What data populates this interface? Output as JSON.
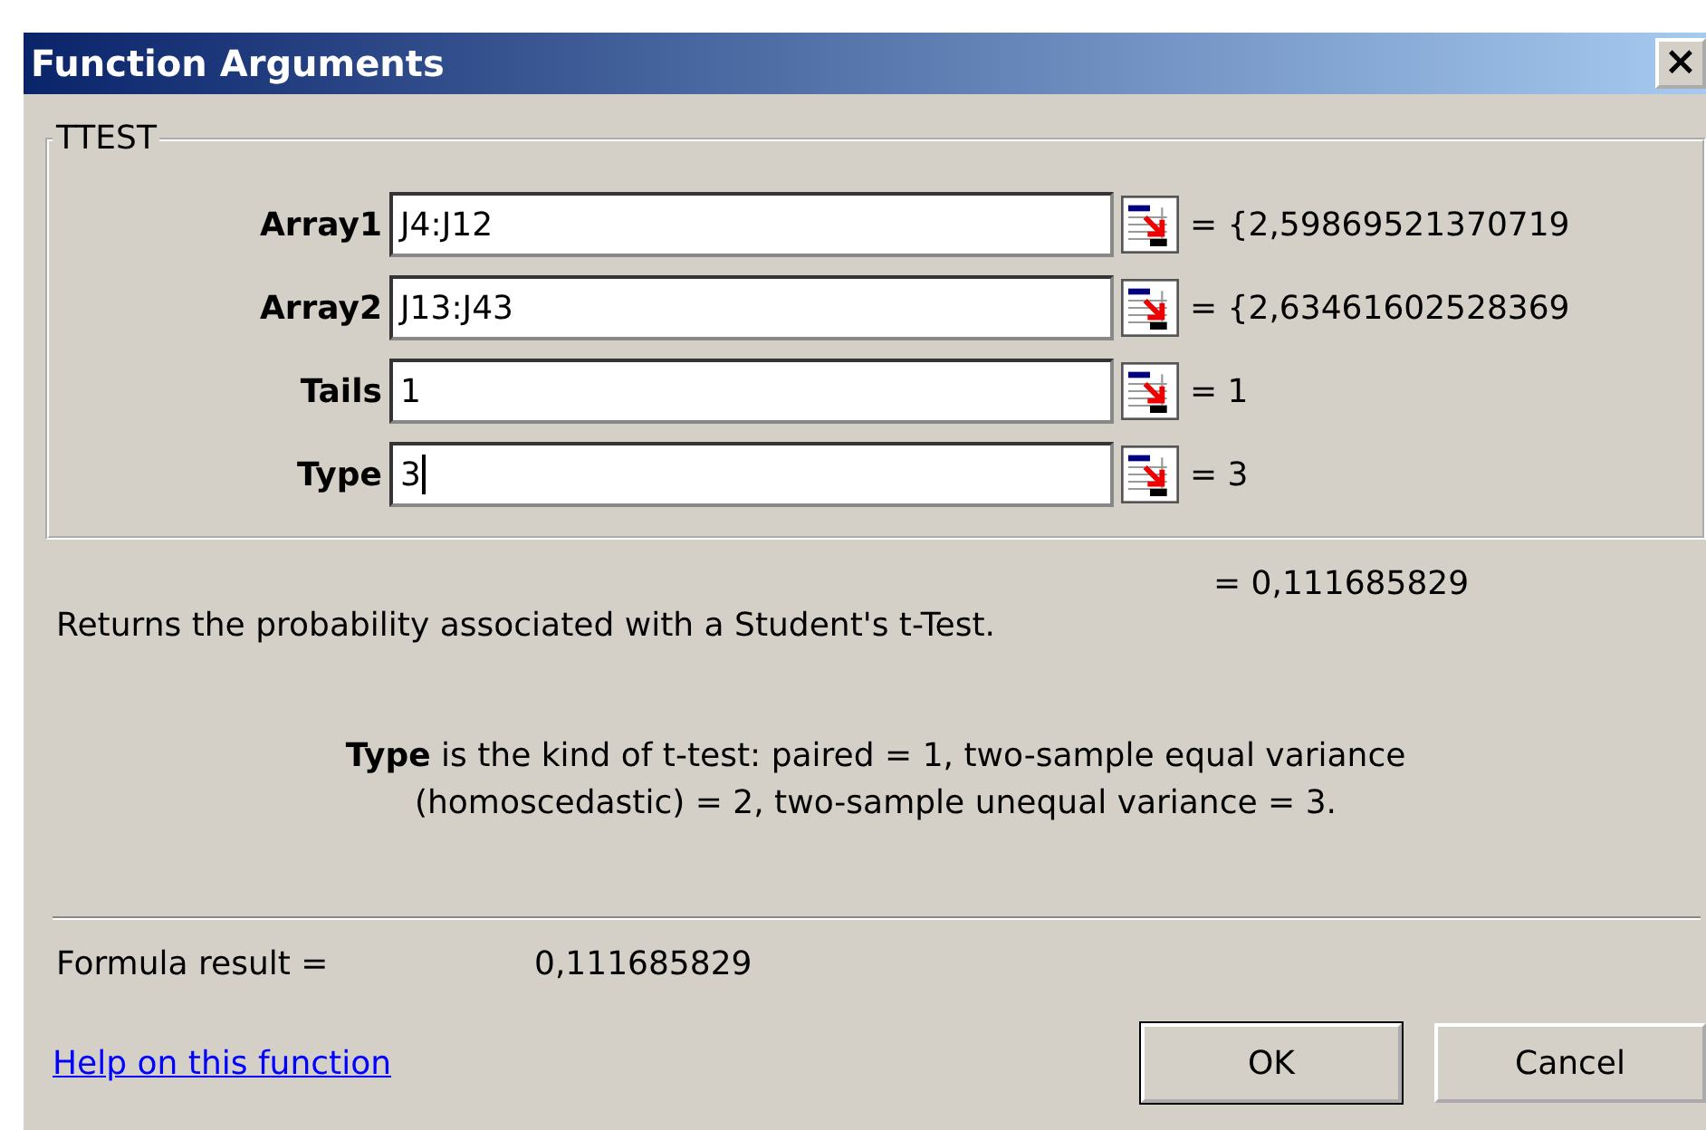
{
  "window": {
    "title": "Function Arguments",
    "close": "×"
  },
  "group": {
    "title": "TTEST",
    "arguments": [
      {
        "label": "Array1",
        "value": "J4:J12",
        "result": "= {2,59869521370719",
        "focused": false
      },
      {
        "label": "Array2",
        "value": "J13:J43",
        "result": "= {2,63461602528369",
        "focused": false
      },
      {
        "label": "Tails",
        "value": "1",
        "result": "= 1",
        "focused": false
      },
      {
        "label": "Type",
        "value": "3",
        "result": "= 3",
        "focused": true
      }
    ]
  },
  "function_result": "= 0,111685829",
  "description": "Returns the probability associated with a Student's t-Test.",
  "argument_help": "**Type** is the kind of t-test: paired = 1, two-sample equal variance (homoscedastic) = 2, two-sample unequal variance = 3.",
  "formula_result": {
    "label": "Formula result =",
    "value": "0,111685829"
  },
  "help_link": "Help on this function",
  "buttons": [
    {
      "label": "OK",
      "default": true
    },
    {
      "label": "Cancel",
      "default": false
    }
  ]
}
